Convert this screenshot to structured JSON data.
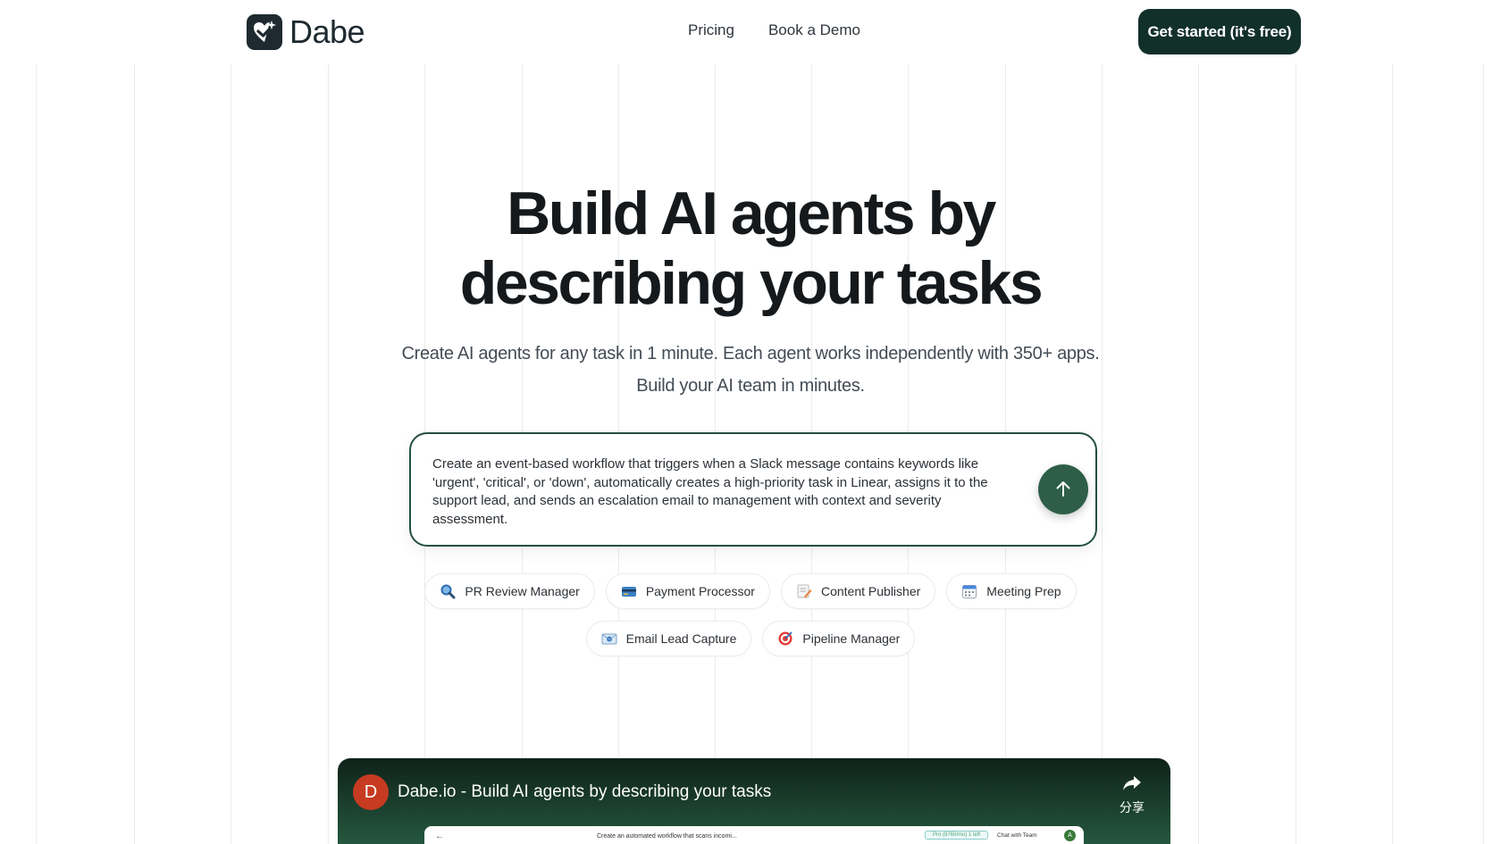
{
  "nav": {
    "brand": "Dabe",
    "links": [
      "Pricing",
      "Book a Demo"
    ],
    "cta": "Get started (it's free)"
  },
  "hero": {
    "title_line1": "Build AI agents by",
    "title_line2": "describing your tasks",
    "subtitle_line1": "Create AI agents for any task in 1 minute. Each agent works independently with 350+ apps.",
    "subtitle_line2": "Build your AI team in minutes."
  },
  "prompt": {
    "text": "Create an event-based workflow that triggers when a Slack message contains keywords like 'urgent', 'critical', or 'down', automatically creates a high-priority task in Linear, assigns it to the support lead, and sends an escalation email to management with context and severity assessment.",
    "send_icon": "arrow-up-icon"
  },
  "chips": {
    "row1": [
      {
        "label": "PR Review Manager",
        "icon": "magnifier-icon"
      },
      {
        "label": "Payment Processor",
        "icon": "credit-card-icon"
      },
      {
        "label": "Content Publisher",
        "icon": "memo-icon"
      },
      {
        "label": "Meeting Prep",
        "icon": "calendar-icon"
      }
    ],
    "row2": [
      {
        "label": "Email Lead Capture",
        "icon": "envelope-icon"
      },
      {
        "label": "Pipeline Manager",
        "icon": "target-icon"
      }
    ]
  },
  "video": {
    "avatar": "D",
    "title": "Dabe.io - Build AI agents by describing your tasks",
    "share_label": "分享",
    "screen": {
      "back": "←",
      "prompt_text": "Create an automated workflow that scans incomi...",
      "badge": "Pro (8760/mo) 1 left",
      "chat": "Chat with Team",
      "avatar": "A"
    }
  }
}
